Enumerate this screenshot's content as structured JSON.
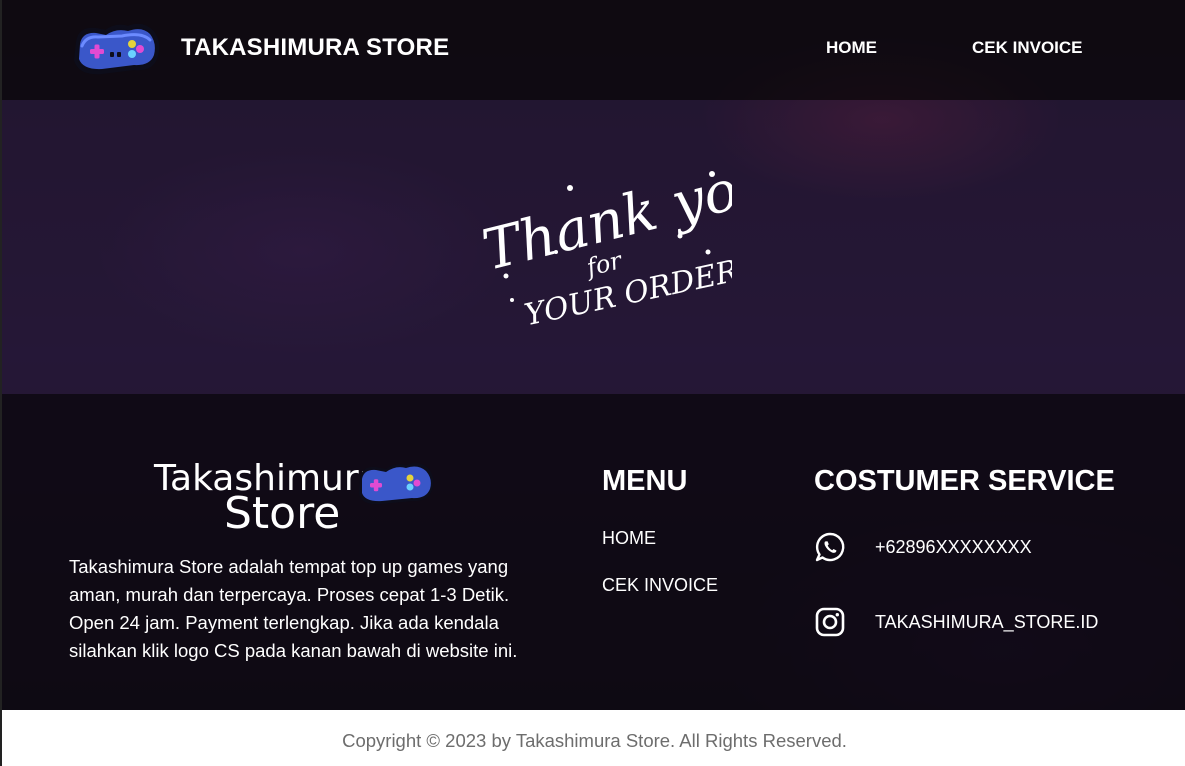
{
  "header": {
    "brand": "TAKASHIMURA STORE",
    "logo_icon": "gamepad-icon",
    "nav": {
      "home": "HOME",
      "cek_invoice": "CEK INVOICE"
    }
  },
  "hero": {
    "image_icon": "thank-you-for-your-order-lettering",
    "lettering": [
      "Thank you",
      "for",
      "YOUR ORDER"
    ]
  },
  "footer": {
    "logo_lettering": [
      "Takashimura",
      "Store"
    ],
    "about": "Takashimura Store adalah tempat top up games yang aman, murah dan terpercaya. Proses cepat 1-3 Detik. Open 24 jam. Payment terlengkap. Jika ada kendala silahkan klik logo CS pada kanan bawah di website ini.",
    "menu": {
      "title": "MENU",
      "items": [
        "HOME",
        "CEK INVOICE"
      ]
    },
    "customer_service": {
      "title": "COSTUMER SERVICE",
      "whatsapp": {
        "icon": "whatsapp-icon",
        "text": "+62896XXXXXXXX"
      },
      "instagram": {
        "icon": "instagram-icon",
        "text": "TAKASHIMURA_STORE.ID"
      }
    }
  },
  "copyright": "Copyright © 2023 by Takashimura Store. All Rights Reserved.",
  "colors": {
    "background_dark": "#1c1324",
    "text_white": "#ffffff",
    "gamepad_blue": "#3a57c9",
    "copyright_gray": "#6d6d6d"
  }
}
